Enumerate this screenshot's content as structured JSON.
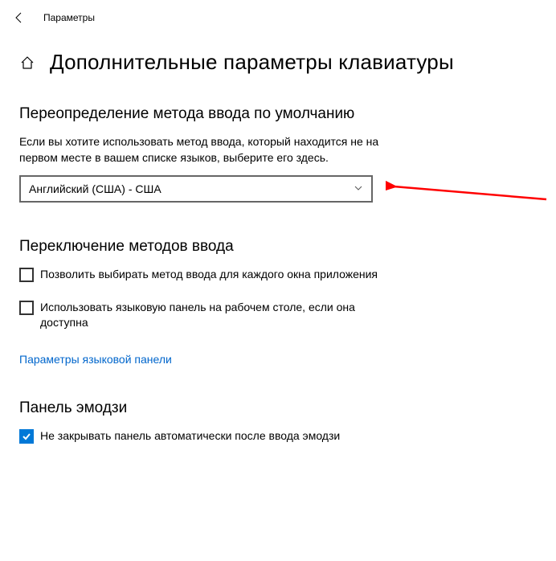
{
  "titlebar": {
    "label": "Параметры"
  },
  "page": {
    "title": "Дополнительные параметры клавиатуры"
  },
  "section_override": {
    "title": "Переопределение метода ввода по умолчанию",
    "desc": "Если вы хотите использовать метод ввода, который находится не на первом месте в вашем списке языков, выберите его здесь.",
    "dropdown_value": "Английский (США) - США"
  },
  "section_switching": {
    "title": "Переключение методов ввода",
    "checkbox1_label": "Позволить выбирать метод ввода для каждого окна приложения",
    "checkbox2_label": "Использовать языковую панель на рабочем столе, если она доступна",
    "link": "Параметры языковой панели"
  },
  "section_emoji": {
    "title": "Панель эмодзи",
    "checkbox_label": "Не закрывать панель автоматически после ввода эмодзи"
  },
  "arrow_color": "#ff0000"
}
